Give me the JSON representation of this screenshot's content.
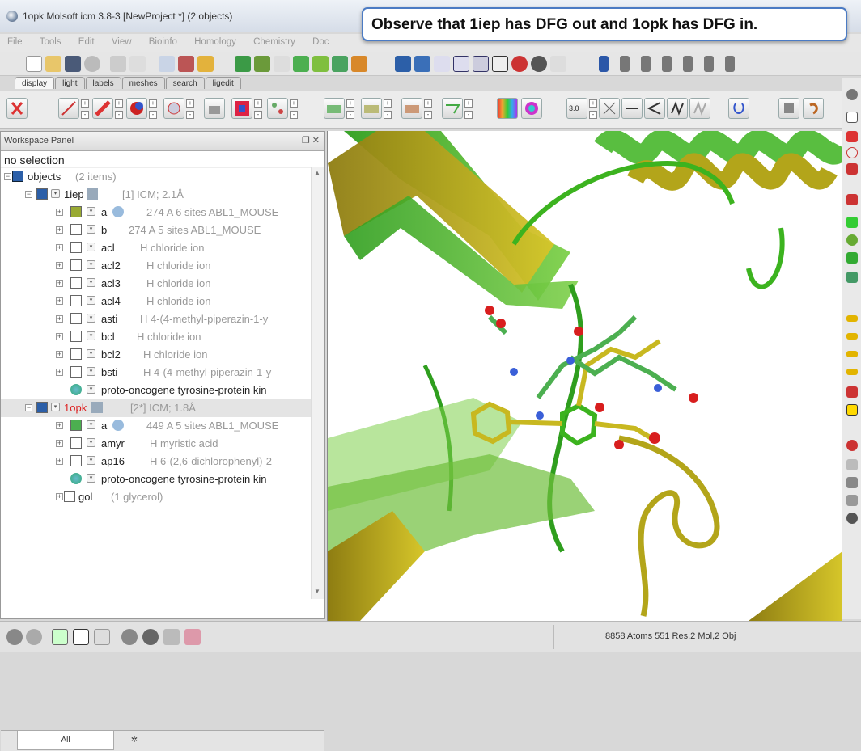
{
  "window": {
    "title": "1opk Molsoft icm 3.8-3  [NewProject *] (2 objects)"
  },
  "callout": {
    "text": "Observe that 1iep has DFG out and 1opk has DFG in."
  },
  "menu": [
    "File",
    "Tools",
    "Edit",
    "View",
    "Bioinfo",
    "Homology",
    "Chemistry",
    "Doc"
  ],
  "tabs": [
    "display",
    "light",
    "labels",
    "meshes",
    "search",
    "ligedit"
  ],
  "toolbar2": {
    "resolution_label": "3.0"
  },
  "workspace": {
    "header": "Workspace Panel",
    "header_buttons": "❐ ✕",
    "selection": "no selection",
    "root": {
      "label": "objects",
      "info": "(2 items)"
    },
    "objects": [
      {
        "name": "1iep",
        "info": "[1] ICM; 2.1Å",
        "children": [
          {
            "label": "a",
            "info": "274 A  6 sites ABL1_MOUSE"
          },
          {
            "label": "b",
            "info": "274 A  5 sites ABL1_MOUSE"
          },
          {
            "label": "acl",
            "info": "H   chloride ion"
          },
          {
            "label": "acl2",
            "info": "H   chloride ion"
          },
          {
            "label": "acl3",
            "info": "H   chloride ion"
          },
          {
            "label": "acl4",
            "info": "H   chloride ion"
          },
          {
            "label": "asti",
            "info": "H   4-(4-methyl-piperazin-1-y"
          },
          {
            "label": "bcl",
            "info": "H   chloride ion"
          },
          {
            "label": "bcl2",
            "info": "H   chloride ion"
          },
          {
            "label": "bsti",
            "info": "H   4-(4-methyl-piperazin-1-y"
          },
          {
            "label": "proto-oncogene tyrosine-protein kin",
            "info": ""
          }
        ]
      },
      {
        "name": "1opk",
        "info": "[2*] ICM; 1.8Å",
        "children": [
          {
            "label": "a",
            "info": "449 A  5 sites ABL1_MOUSE"
          },
          {
            "label": "amyr",
            "info": "H   myristic acid"
          },
          {
            "label": "ap16",
            "info": "H   6-(2,6-dichlorophenyl)-2"
          },
          {
            "label": "proto-oncogene tyrosine-protein kin",
            "info": ""
          }
        ]
      }
    ],
    "extra": {
      "label": "gol",
      "info": "(1 glycerol)"
    },
    "bottom_tabs": [
      "All",
      ""
    ]
  },
  "status": {
    "text": "8858 Atoms 551 Res,2 Mol,2 Obj"
  },
  "colors": {
    "green_ribbon": "#3cb31f",
    "olive_ribbon": "#b3a51a",
    "oxygen": "#d81e1e",
    "nitrogen": "#3a5fd8",
    "accent_border": "#4b7bc4"
  }
}
